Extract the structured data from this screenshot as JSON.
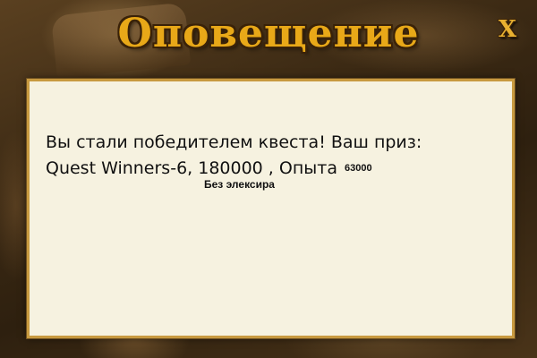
{
  "dialog": {
    "title": "Оповещение",
    "close_label": "X",
    "message_line1": "Вы стали победителем квеста! Ваш приз:",
    "message_line2": "Quest Winners-6, 180000 , Опыта",
    "exp_value": "63000",
    "note": "Без элексира"
  },
  "colors": {
    "title": "#e8a818",
    "panel_bg": "#f6f2e0",
    "panel_border": "#c89a40",
    "text": "#111111"
  },
  "icons": {
    "close": "close-icon"
  }
}
